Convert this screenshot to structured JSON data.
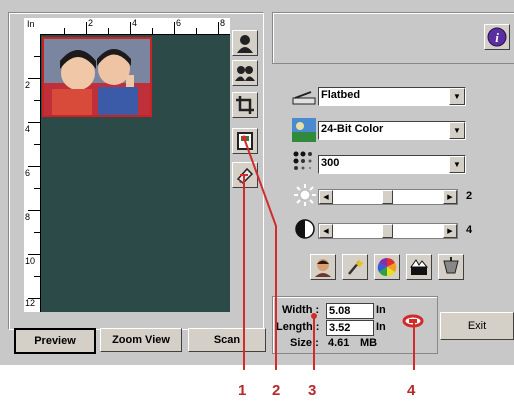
{
  "ruler": {
    "unit": "In",
    "top_labels": [
      "2",
      "4",
      "6",
      "8"
    ],
    "left_labels": [
      "2",
      "4",
      "6",
      "8",
      "10",
      "12"
    ]
  },
  "buttons": {
    "preview": "Preview",
    "zoom_view": "Zoom View",
    "scan": "Scan",
    "exit": "Exit"
  },
  "tools": [
    {
      "name": "auto-scan-icon"
    },
    {
      "name": "multi-scan-icon"
    },
    {
      "name": "crop-icon"
    },
    {
      "name": "frame-icon"
    },
    {
      "name": "eraser-icon"
    }
  ],
  "settings": {
    "source": "Flatbed",
    "color_mode": "24-Bit Color",
    "resolution": "300",
    "brightness": {
      "value": "2",
      "level": 0.5
    },
    "contrast": {
      "value": "4",
      "level": 0.5
    }
  },
  "size": {
    "width_label": "Width :",
    "width_value": "5.08",
    "width_unit": "In",
    "length_label": "Length :",
    "length_value": "3.52",
    "length_unit": "In",
    "size_label": "Size :",
    "size_value": "4.61",
    "size_unit": "MB"
  },
  "callouts": [
    "1",
    "2",
    "3",
    "4"
  ],
  "colors": {
    "callout": "#d12b2b",
    "preview_bg": "#2b4a48",
    "info_button": "#5a2fa0"
  }
}
